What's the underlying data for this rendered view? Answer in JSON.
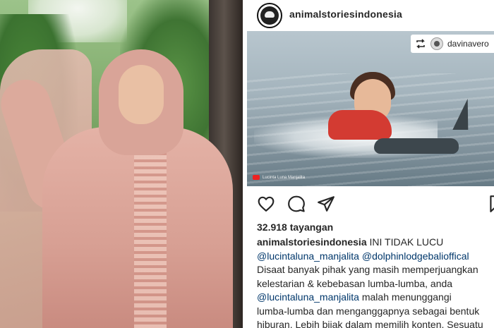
{
  "post": {
    "username": "animalstoriesindonesia",
    "repost": {
      "name": "davinavero"
    },
    "video_credit": "Lucinta Luna Manjalita",
    "views": "32.918 tayangan",
    "caption": {
      "author": "animalstoriesindonesia",
      "headline": "INI TIDAK LUCU",
      "mention1": "@lucintaluna_manjalita",
      "mention2": "@dolphinlodgebalioffical",
      "line3": "Disaat banyak pihak yang masih memperjuangkan",
      "line4": "kelestarian & kebebasan lumba-lumba, anda",
      "mention3": "@lucintaluna_manjalita",
      "line5_tail": " malah menunggangi",
      "line6": "lumba-lumba dan menganggapnya sebagai bentuk",
      "line7": "hiburan. Lebih bijak dalam memilih konten. Sesuatu"
    }
  },
  "icons": {
    "like": "heart-icon",
    "comment": "comment-icon",
    "share": "send-icon",
    "save": "bookmark-icon",
    "repost": "repost-icon"
  },
  "colors": {
    "text": "#262626",
    "mention": "#00376b",
    "life_vest": "#d33b32"
  }
}
